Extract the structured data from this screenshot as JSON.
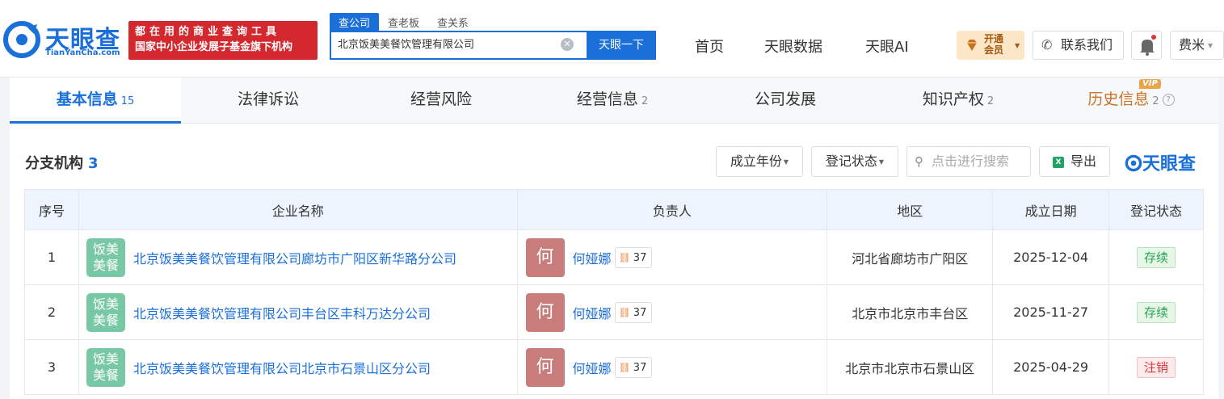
{
  "header": {
    "logo_text": "天眼查",
    "logo_sub": "TianYanCha.com",
    "banner_line1": "都在用的商业查询工具",
    "banner_line2": "国家中小企业发展子基金旗下机构",
    "search_tabs": [
      "查公司",
      "查老板",
      "查关系"
    ],
    "search_value": "北京饭美美餐饮管理有限公司",
    "search_button": "天眼一下",
    "nav": [
      "首页",
      "天眼数据",
      "天眼AI"
    ],
    "vip_line1": "开通",
    "vip_line2": "会员",
    "contact": "联系我们",
    "user": "费米"
  },
  "tabs": [
    {
      "label": "基本信息",
      "count": "15"
    },
    {
      "label": "法律诉讼",
      "count": ""
    },
    {
      "label": "经营风险",
      "count": ""
    },
    {
      "label": "经营信息",
      "count": "2"
    },
    {
      "label": "公司发展",
      "count": ""
    },
    {
      "label": "知识产权",
      "count": "2"
    },
    {
      "label": "历史信息",
      "count": "2"
    }
  ],
  "vip_tag": "VIP",
  "section": {
    "title": "分支机构",
    "count": "3",
    "filter_year": "成立年份",
    "filter_status": "登记状态",
    "search_placeholder": "点击进行搜索",
    "export": "导出",
    "watermark": "天眼查"
  },
  "table": {
    "headers": [
      "序号",
      "企业名称",
      "负责人",
      "地区",
      "成立日期",
      "登记状态"
    ],
    "rows": [
      {
        "idx": "1",
        "logo1": "饭美",
        "logo2": "美餐",
        "name": "北京饭美美餐饮管理有限公司廊坊市广阳区新华路分公司",
        "avatar": "何",
        "person": "何娅娜",
        "rel": "37",
        "region": "河北省廊坊市广阳区",
        "date": "2025-12-04",
        "status": "存续"
      },
      {
        "idx": "2",
        "logo1": "饭美",
        "logo2": "美餐",
        "name": "北京饭美美餐饮管理有限公司丰台区丰科万达分公司",
        "avatar": "何",
        "person": "何娅娜",
        "rel": "37",
        "region": "北京市北京市丰台区",
        "date": "2025-11-27",
        "status": "存续"
      },
      {
        "idx": "3",
        "logo1": "饭美",
        "logo2": "美餐",
        "name": "北京饭美美餐饮管理有限公司北京市石景山区分公司",
        "avatar": "何",
        "person": "何娅娜",
        "rel": "37",
        "region": "北京市北京市石景山区",
        "date": "2025-04-29",
        "status": "注销"
      }
    ]
  },
  "colors": {
    "accent": "#1a6fd8",
    "banner": "#d4282f",
    "active_status": "#2aa35a",
    "cancelled_status": "#d9363e"
  }
}
